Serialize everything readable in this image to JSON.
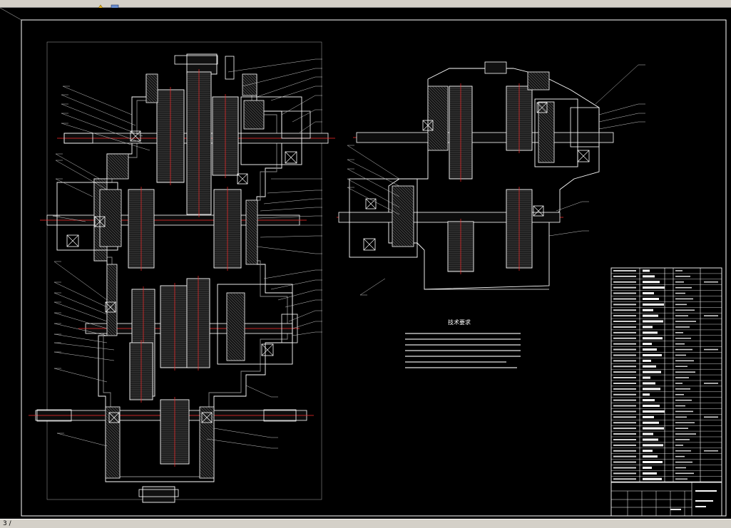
{
  "status_text": "3 /",
  "technical_title": "技术要求",
  "colors": {
    "background": "#000000",
    "outline": "#ffffff",
    "centerline": "#ff2a2a",
    "section": "#9a9a9a",
    "leader": "#c8c8c8",
    "chrome": "#d4d0c8"
  },
  "icons": [
    "tool-icon",
    "shape-icon"
  ]
}
